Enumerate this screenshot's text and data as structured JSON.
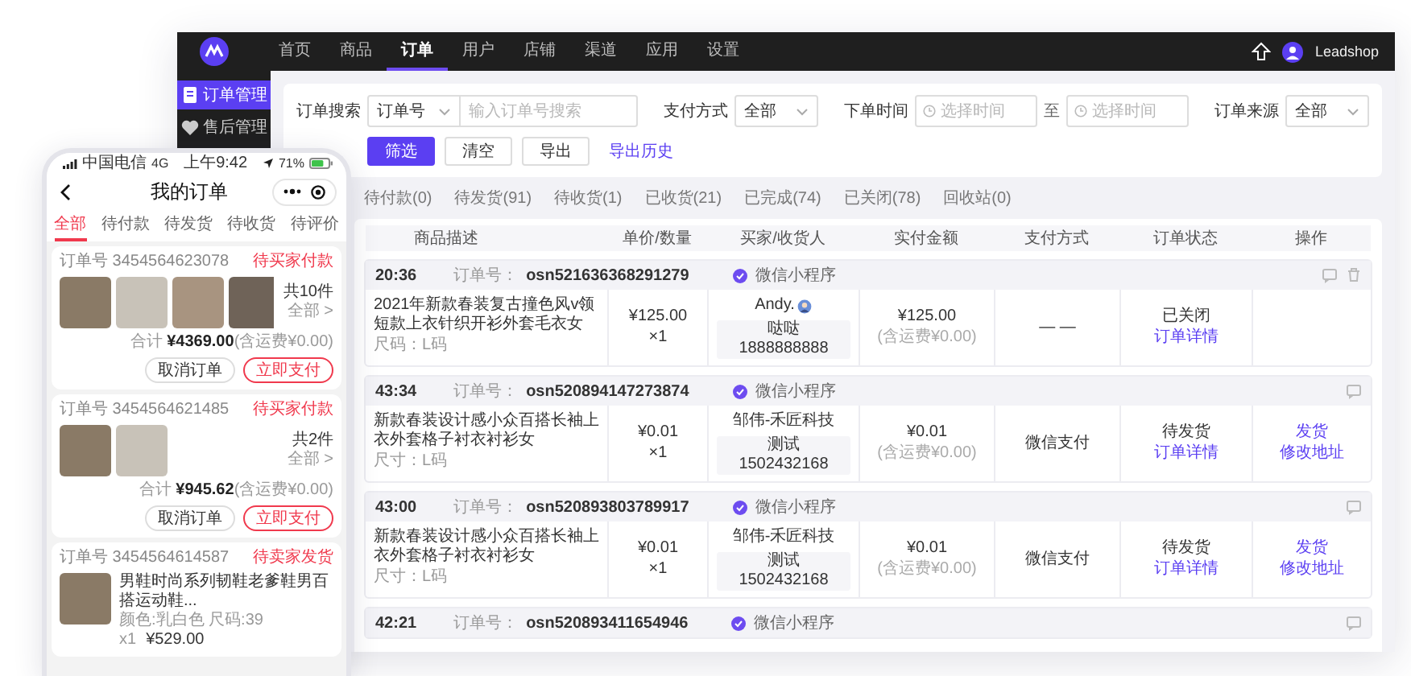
{
  "desktop": {
    "nav": {
      "items": [
        {
          "label": "首页",
          "selected": false
        },
        {
          "label": "商品",
          "selected": false
        },
        {
          "label": "订单",
          "selected": true
        },
        {
          "label": "用户",
          "selected": false
        },
        {
          "label": "店铺",
          "selected": false
        },
        {
          "label": "渠道",
          "selected": false
        },
        {
          "label": "应用",
          "selected": false
        },
        {
          "label": "设置",
          "selected": false
        }
      ],
      "user": "Leadshop"
    },
    "sidebar": {
      "items": [
        {
          "label": "订单管理",
          "kind": "order",
          "selected": true
        },
        {
          "label": "售后管理",
          "kind": "aftersale",
          "selected": false
        }
      ]
    },
    "filters": {
      "fields": [
        {
          "kind": "search",
          "label": "订单搜索",
          "select": "订单号",
          "placeholder": "输入订单号搜索"
        },
        {
          "kind": "select",
          "label": "支付方式",
          "value": "全部"
        },
        {
          "kind": "daterange",
          "label": "下单时间",
          "start_placeholder": "选择时间",
          "separator": "至",
          "end_placeholder": "选择时间"
        },
        {
          "kind": "select",
          "label": "订单来源",
          "value": "全部"
        }
      ],
      "buttons": [
        {
          "label": "筛选",
          "kind": "primary"
        },
        {
          "label": "清空",
          "kind": "default"
        },
        {
          "label": "导出",
          "kind": "default"
        },
        {
          "label": "导出历史",
          "kind": "link"
        }
      ]
    },
    "status_tabs": [
      {
        "label": "待付款(0)",
        "selected": false
      },
      {
        "label": "待发货(91)",
        "selected": false
      },
      {
        "label": "待收货(1)",
        "selected": false
      },
      {
        "label": "已收货(21)",
        "selected": false
      },
      {
        "label": "已完成(74)",
        "selected": false
      },
      {
        "label": "已关闭(78)",
        "selected": false
      },
      {
        "label": "回收站(0)",
        "selected": false
      }
    ],
    "table": {
      "columns": [
        "商品描述",
        "单价/数量",
        "买家/收货人",
        "实付金额",
        "支付方式",
        "订单状态",
        "操作"
      ],
      "rows": [
        {
          "time": "20:36",
          "order_no_label": "订单号：",
          "order_no": "osn521636368291279",
          "source": "微信小程序",
          "header_icons": [
            {
              "kind": "message"
            },
            {
              "kind": "delete"
            }
          ],
          "product": {
            "title": "2021年新款春装复古撞色风v领短款上衣针织开衫外套毛衣女",
            "spec": "尺码：L码"
          },
          "price": "¥125.00",
          "quantity": "×1",
          "buyer": "Andy.",
          "buyer_icon": true,
          "receiver": "哒哒",
          "receiver_phone": "1888888888",
          "paid": "¥125.00",
          "freight": "(含运费¥0.00)",
          "payment": "— —",
          "status": "已关闭",
          "status_links": [
            "订单详情"
          ]
        },
        {
          "time": "43:34",
          "order_no_label": "订单号：",
          "order_no": "osn520894147273874",
          "source": "微信小程序",
          "header_icons": [
            {
              "kind": "message"
            }
          ],
          "product": {
            "title": "新款春装设计感小众百搭长袖上衣外套格子衬衣衬衫女",
            "spec": "尺寸：L码"
          },
          "price": "¥0.01",
          "quantity": "×1",
          "buyer": "邹伟-禾匠科技",
          "receiver": "测试",
          "receiver_phone": "1502432168",
          "paid": "¥0.01",
          "freight": "(含运费¥0.00)",
          "payment": "微信支付",
          "status": "待发货",
          "status_links": [
            "订单详情"
          ],
          "operations": [
            "发货",
            "修改地址"
          ]
        },
        {
          "time": "43:00",
          "order_no_label": "订单号：",
          "order_no": "osn520893803789917",
          "source": "微信小程序",
          "header_icons": [
            {
              "kind": "message"
            }
          ],
          "product": {
            "title": "新款春装设计感小众百搭长袖上衣外套格子衬衣衬衫女",
            "spec": "尺寸：L码"
          },
          "price": "¥0.01",
          "quantity": "×1",
          "buyer": "邹伟-禾匠科技",
          "receiver": "测试",
          "receiver_phone": "1502432168",
          "paid": "¥0.01",
          "freight": "(含运费¥0.00)",
          "payment": "微信支付",
          "status": "待发货",
          "status_links": [
            "订单详情"
          ],
          "operations": [
            "发货",
            "修改地址"
          ]
        },
        {
          "time": "42:21",
          "order_no_label": "订单号：",
          "order_no": "osn520893411654946",
          "source": "微信小程序",
          "header_icons": [
            {
              "kind": "message"
            }
          ]
        }
      ]
    }
  },
  "phone": {
    "status_bar": {
      "carrier": "中国电信",
      "network": "4G",
      "time": "上午9:42",
      "battery": "71%"
    },
    "title": "我的订单",
    "tabs": [
      {
        "label": "全部",
        "selected": true
      },
      {
        "label": "待付款",
        "selected": false
      },
      {
        "label": "待发货",
        "selected": false
      },
      {
        "label": "待收货",
        "selected": false
      },
      {
        "label": "待评价",
        "selected": false
      }
    ],
    "orders": [
      {
        "order_no": "订单号 3454564623078",
        "status": "待买家付款",
        "images": [
          {
            "kind": "photo"
          },
          {
            "kind": "photo"
          },
          {
            "kind": "photo"
          },
          {
            "kind": "photo"
          }
        ],
        "count": "共10件",
        "more": "全部 >",
        "total": "合计 **¥4369.00**(含运费¥0.00)",
        "buttons": [
          {
            "label": "取消订单",
            "kind": "default"
          },
          {
            "label": "立即支付",
            "kind": "primary"
          }
        ]
      },
      {
        "order_no": "订单号 3454564621485",
        "status": "待买家付款",
        "images": [
          {
            "kind": "photo"
          },
          {
            "kind": "photo"
          }
        ],
        "count": "共2件",
        "more": "全部 >",
        "total": "合计 **¥945.62**(含运费¥0.00)",
        "buttons": [
          {
            "label": "取消订单",
            "kind": "default"
          },
          {
            "label": "立即支付",
            "kind": "primary"
          }
        ]
      },
      {
        "order_no": "订单号 3454564614587",
        "status": "待卖家发货",
        "images": [
          {
            "kind": "photo"
          }
        ],
        "item": {
          "title": "男鞋时尚系列韧鞋老爹鞋男百搭运动鞋...",
          "spec": "颜色:乳白色 尺码:39",
          "quantity": "x1",
          "price": "¥529.00"
        }
      }
    ]
  }
}
